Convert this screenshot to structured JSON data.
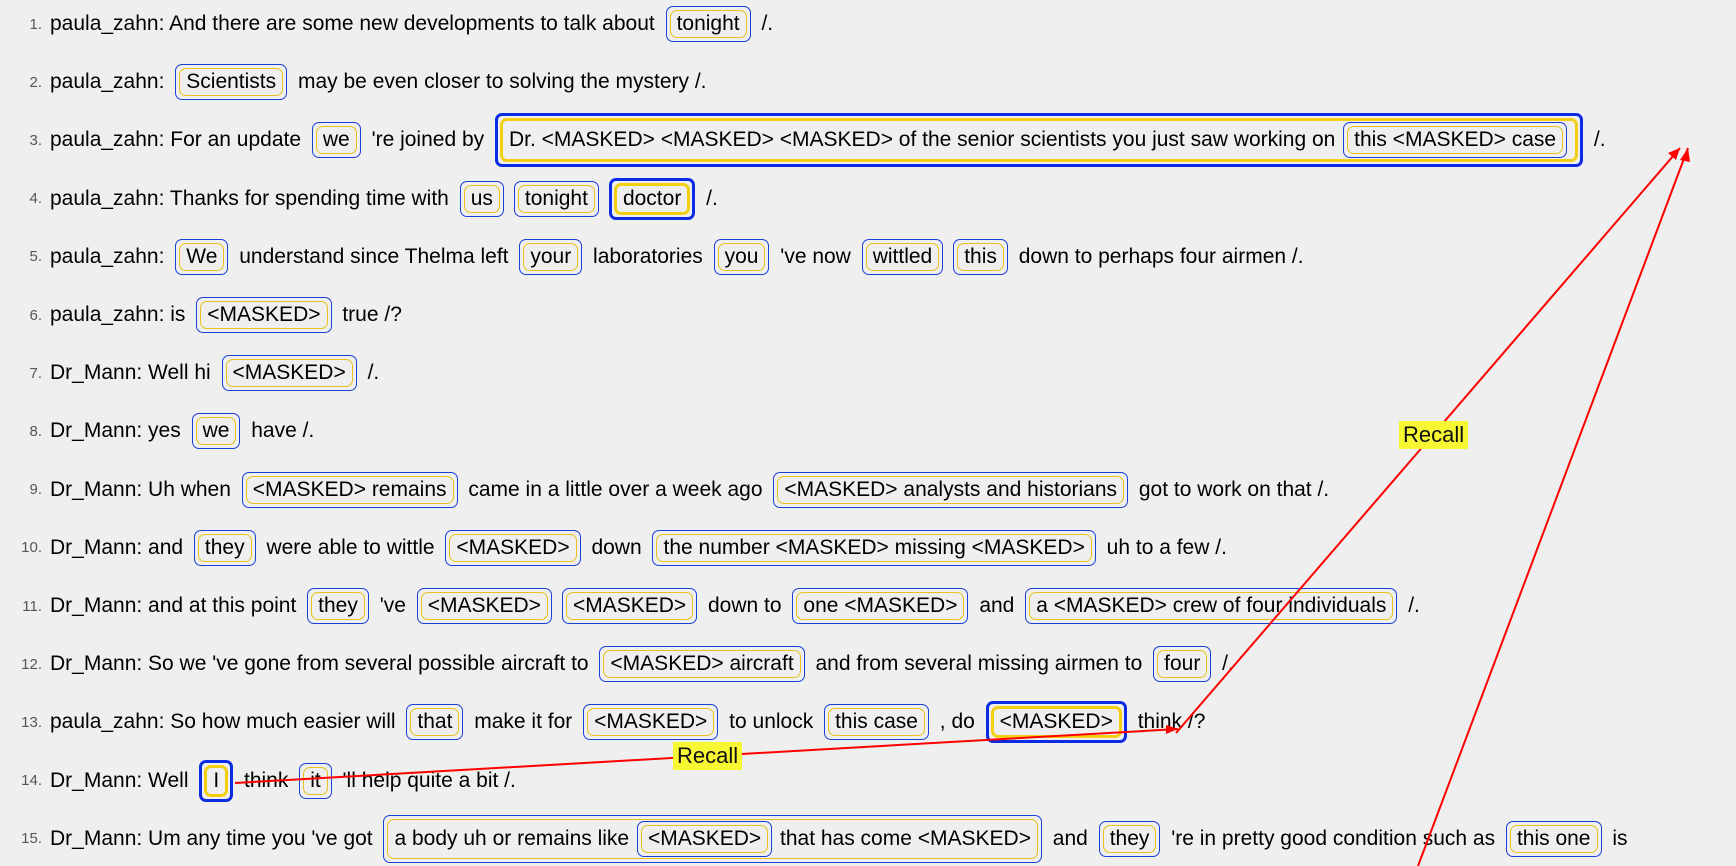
{
  "lines": [
    {
      "n": "1.",
      "parts": [
        {
          "t": "paula_zahn: And there are some new developments to talk about "
        },
        {
          "m": "tonight"
        },
        {
          "t": " /."
        }
      ]
    },
    {
      "n": "2.",
      "parts": [
        {
          "t": "paula_zahn: "
        },
        {
          "m": "Scientists"
        },
        {
          "t": " may be even closer to solving the mystery /."
        }
      ]
    },
    {
      "n": "3.",
      "parts": [
        {
          "t": "paula_zahn: For an update "
        },
        {
          "m": "we"
        },
        {
          "t": " 're joined by "
        },
        {
          "m": "Dr. <MASKED> <MASKED> <MASKED> of the senior scientists you just saw working on ",
          "inner": "this <MASKED> case",
          "thick": true
        },
        {
          "t": " /."
        }
      ]
    },
    {
      "n": "4.",
      "parts": [
        {
          "t": "paula_zahn: Thanks for spending time with "
        },
        {
          "m": "us"
        },
        {
          "m": "tonight"
        },
        {
          "m": "doctor",
          "thick": true
        },
        {
          "t": " /."
        }
      ]
    },
    {
      "n": "5.",
      "parts": [
        {
          "t": "paula_zahn: "
        },
        {
          "m": "We"
        },
        {
          "t": " understand since Thelma left "
        },
        {
          "m": "your"
        },
        {
          "t": " laboratories "
        },
        {
          "m": "you"
        },
        {
          "t": " 've now "
        },
        {
          "m": "wittled"
        },
        {
          "m": "this"
        },
        {
          "t": " down to perhaps four airmen /."
        }
      ]
    },
    {
      "n": "6.",
      "parts": [
        {
          "t": "paula_zahn: is "
        },
        {
          "m": "<MASKED>"
        },
        {
          "t": " true /?"
        }
      ]
    },
    {
      "n": "7.",
      "parts": [
        {
          "t": "Dr_Mann: Well hi "
        },
        {
          "m": "<MASKED>"
        },
        {
          "t": " /."
        }
      ]
    },
    {
      "n": "8.",
      "parts": [
        {
          "t": "Dr_Mann: yes "
        },
        {
          "m": "we"
        },
        {
          "t": " have /."
        }
      ]
    },
    {
      "n": "9.",
      "parts": [
        {
          "t": "Dr_Mann: Uh when "
        },
        {
          "m": "<MASKED> remains"
        },
        {
          "t": " came in a little over a week ago "
        },
        {
          "m": "<MASKED>",
          "tail": " analysts and historians"
        },
        {
          "t": " got to work on that /."
        }
      ]
    },
    {
      "n": "10.",
      "parts": [
        {
          "t": "Dr_Mann: and "
        },
        {
          "m": "they"
        },
        {
          "t": " were able to wittle "
        },
        {
          "m": "<MASKED>"
        },
        {
          "t": " down "
        },
        {
          "m": "the number <MASKED> missing <MASKED>"
        },
        {
          "t": " uh to a few /."
        }
      ]
    },
    {
      "n": "11.",
      "parts": [
        {
          "t": "Dr_Mann: and at this point "
        },
        {
          "m": "they"
        },
        {
          "t": " 've "
        },
        {
          "m": "<MASKED>"
        },
        {
          "m": "<MASKED>"
        },
        {
          "t": " down to "
        },
        {
          "m": "one <MASKED>"
        },
        {
          "t": " and "
        },
        {
          "m": "a <MASKED> crew of four individuals"
        },
        {
          "t": " /."
        }
      ]
    },
    {
      "n": "12.",
      "parts": [
        {
          "t": "Dr_Mann: So we 've gone from several possible aircraft to "
        },
        {
          "m": "<MASKED> aircraft"
        },
        {
          "t": " and from several missing airmen to "
        },
        {
          "m": "four"
        },
        {
          "t": " /."
        }
      ]
    },
    {
      "n": "13.",
      "parts": [
        {
          "t": "paula_zahn: So how much easier will "
        },
        {
          "m": "that"
        },
        {
          "t": " make it for "
        },
        {
          "m": "<MASKED>"
        },
        {
          "t": " to unlock "
        },
        {
          "m": "this case"
        },
        {
          "t": " , do "
        },
        {
          "m": "<MASKED>",
          "thick": true
        },
        {
          "t": " think /?"
        }
      ]
    },
    {
      "n": "14.",
      "parts": [
        {
          "t": "Dr_Mann: Well "
        },
        {
          "m": "I",
          "thick": true
        },
        {
          "t": " think "
        },
        {
          "m": "it"
        },
        {
          "t": " 'll help quite a bit /."
        }
      ]
    },
    {
      "n": "15.",
      "parts": [
        {
          "t": "Dr_Mann: Um any time you 've got "
        },
        {
          "m": "a body uh or remains like ",
          "inner": "<MASKED>",
          "tail": " that has come <MASKED>"
        },
        {
          "t": " and "
        },
        {
          "m": "they"
        },
        {
          "t": " 're in pretty good condition such as "
        },
        {
          "m": "this one"
        },
        {
          "t": " is"
        }
      ]
    }
  ],
  "labels": {
    "recall_upper": "Recall",
    "recall_lower": "Recall"
  },
  "colors": {
    "arrow": "#ff0000",
    "outer": "#1a3fd6",
    "inner": "#e6c21a",
    "label_bg": "#f7f734"
  }
}
